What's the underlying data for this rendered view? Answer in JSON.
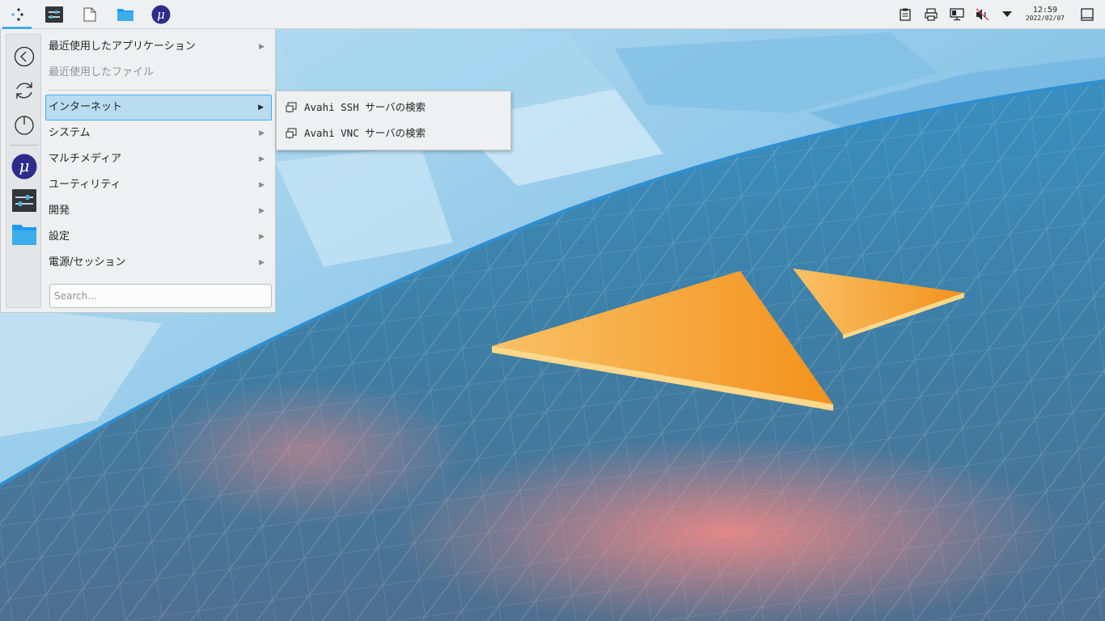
{
  "panel": {
    "launchers": [
      {
        "name": "application-launcher",
        "icon": "kde-launcher-icon"
      },
      {
        "name": "system-settings",
        "icon": "settings-sliders-icon"
      },
      {
        "name": "text-editor",
        "icon": "document-icon"
      },
      {
        "name": "file-manager",
        "icon": "folder-icon"
      },
      {
        "name": "mu-app",
        "icon": "mu-icon"
      }
    ],
    "tray": [
      "clipboard-icon",
      "printer-icon",
      "network-icon",
      "volume-muted-icon",
      "expand-tray-icon"
    ],
    "clock": {
      "time": "12:59",
      "date": "2022/02/07"
    },
    "show_desktop_icon": "show-desktop-icon"
  },
  "menu": {
    "favorites": [
      "back-icon",
      "refresh-icon",
      "power-icon",
      "mu-icon",
      "settings-sliders-icon",
      "folder-icon"
    ],
    "items": [
      {
        "label": "最近使用したアプリケーション",
        "submenu": true,
        "disabled": false
      },
      {
        "label": "最近使用したファイル",
        "submenu": false,
        "disabled": true
      },
      {
        "label": "インターネット",
        "submenu": true,
        "active": true
      },
      {
        "label": "システム",
        "submenu": true
      },
      {
        "label": "マルチメディア",
        "submenu": true
      },
      {
        "label": "ユーティリティ",
        "submenu": true
      },
      {
        "label": "開発",
        "submenu": true
      },
      {
        "label": "設定",
        "submenu": true
      },
      {
        "label": "電源/セッション",
        "submenu": true
      }
    ],
    "search_placeholder": "Search…",
    "arrow": "▶"
  },
  "submenu": {
    "items": [
      {
        "label": "Avahi SSH サーバの検索",
        "icon": "remote-desktop-icon"
      },
      {
        "label": "Avahi VNC サーバの検索",
        "icon": "remote-desktop-icon"
      }
    ]
  },
  "colors": {
    "accent": "#3daee9",
    "highlight": "#b9dcf1",
    "panel": "#eff0f1",
    "mu": "#2d2c8a",
    "orange": "#f5a33c"
  }
}
